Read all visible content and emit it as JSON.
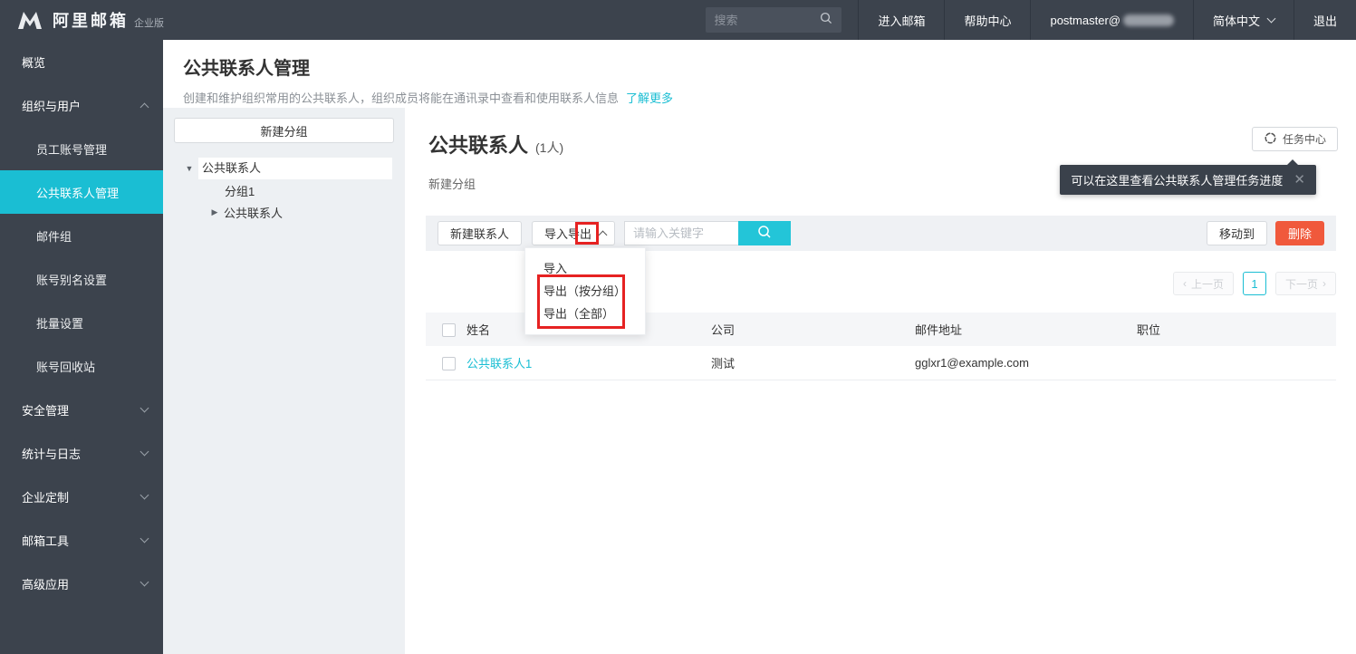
{
  "topbar": {
    "brand": "阿里邮箱",
    "brand_badge": "企业版",
    "search_placeholder": "搜索",
    "enter_mailbox": "进入邮箱",
    "help_center": "帮助中心",
    "account_prefix": "postmaster@",
    "language": "简体中文",
    "logout": "退出"
  },
  "sidebar": {
    "overview": "概览",
    "org_users": "组织与用户",
    "org_sub": [
      "员工账号管理",
      "公共联系人管理",
      "邮件组",
      "账号别名设置",
      "批量设置",
      "账号回收站"
    ],
    "active_item": "公共联系人管理",
    "groups": [
      "安全管理",
      "统计与日志",
      "企业定制",
      "邮箱工具",
      "高级应用"
    ]
  },
  "page_header": {
    "title": "公共联系人管理",
    "description": "创建和维护组织常用的公共联系人，组织成员将能在通讯录中查看和使用联系人信息",
    "learn_more": "了解更多"
  },
  "tree_panel": {
    "new_group_button": "新建分组",
    "root_label": "公共联系人",
    "child_group": "分组1",
    "child_folder": "公共联系人"
  },
  "content": {
    "title": "公共联系人",
    "count": "(1人)",
    "new_group_link": "新建分组",
    "task_center_button": "任务中心",
    "tooltip_text": "可以在这里查看公共联系人管理任务进度",
    "toolbar": {
      "new_contact": "新建联系人",
      "import_export": "导入导出",
      "search_placeholder": "请输入关键字",
      "move_to": "移动到",
      "delete": "删除"
    },
    "dropdown_items": [
      "导入",
      "导出（按分组）",
      "导出（全部）"
    ],
    "pagination": {
      "prev": "上一页",
      "current": "1",
      "next": "下一页"
    },
    "table": {
      "headers": [
        "姓名",
        "公司",
        "邮件地址",
        "职位"
      ],
      "rows": [
        {
          "name": "公共联系人1",
          "company": "测试",
          "email": "gglxr1@example.com",
          "position": ""
        }
      ]
    }
  },
  "colors": {
    "accent": "#1abed3",
    "danger": "#f0593c",
    "annotation_red": "#e62222",
    "sidebar_bg": "#3c434d"
  }
}
